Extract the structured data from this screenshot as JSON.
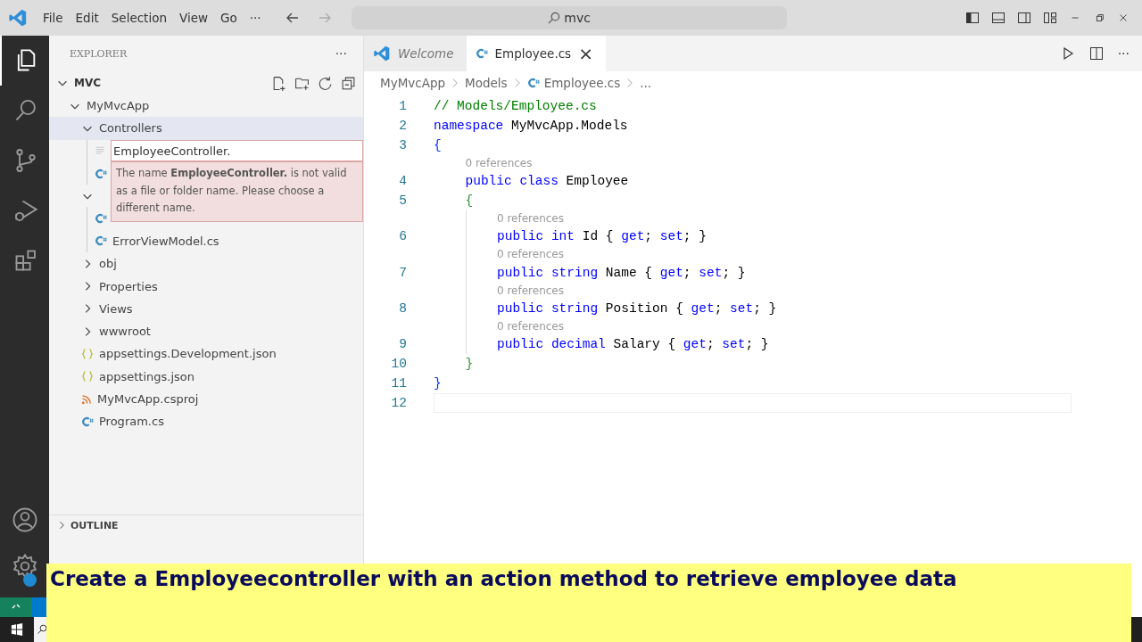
{
  "menu": [
    "File",
    "Edit",
    "Selection",
    "View",
    "Go",
    "···"
  ],
  "search": {
    "value": "mvc"
  },
  "activity_bar": [
    {
      "kind": "explorer",
      "selected": true
    },
    {
      "kind": "search",
      "selected": false
    },
    {
      "kind": "source-control",
      "selected": false
    },
    {
      "kind": "run-debug",
      "selected": false
    },
    {
      "kind": "extensions",
      "selected": false
    }
  ],
  "sidebar": {
    "title": "EXPLORER",
    "more": "···",
    "root": "MVC",
    "tree": [
      {
        "label": "MyMvcApp",
        "kind": "folder",
        "expanded": true,
        "children": [
          {
            "label": "Controllers",
            "kind": "folder",
            "expanded": true,
            "selected": true,
            "children": [
              {
                "kind": "rename",
                "value": "EmployeeController."
              },
              {
                "kind": "csharp"
              }
            ]
          },
          {
            "kind": "folder",
            "expanded": true,
            "children": [
              {
                "kind": "csharp"
              },
              {
                "label": "ErrorViewModel.cs",
                "kind": "csharp"
              }
            ]
          },
          {
            "label": "obj",
            "kind": "folder",
            "expanded": false
          },
          {
            "label": "Properties",
            "kind": "folder",
            "expanded": false
          },
          {
            "label": "Views",
            "kind": "folder",
            "expanded": false
          },
          {
            "label": "wwwroot",
            "kind": "folder",
            "expanded": false
          },
          {
            "label": "appsettings.Development.json",
            "kind": "json"
          },
          {
            "label": "appsettings.json",
            "kind": "json"
          },
          {
            "label": "MyMvcApp.csproj",
            "kind": "rss"
          },
          {
            "label": "Program.cs",
            "kind": "csharp"
          }
        ]
      }
    ],
    "error": "The name **EmployeeController.** is not valid as a file or folder name. Please choose a different name.",
    "outline": "OUTLINE"
  },
  "tabs": [
    {
      "label": "Welcome",
      "kind": "vscode",
      "selected": false
    },
    {
      "label": "Employee.cs",
      "kind": "csharp",
      "selected": true,
      "close": "×"
    }
  ],
  "breadcrumbs": [
    "MyMvcApp",
    "Models",
    "Employee.cs",
    "..."
  ],
  "code": [
    {
      "number": "1",
      "tokens": [
        {
          "t": "// Models/Employee.cs",
          "kind": "comment"
        }
      ]
    },
    {
      "number": "2",
      "tokens": [
        {
          "t": "namespace",
          "kind": "keyword"
        },
        {
          "t": " MyMvcApp.Models",
          "kind": "plain"
        }
      ]
    },
    {
      "number": "3",
      "tokens": [
        {
          "t": "{",
          "kind": "brace"
        }
      ]
    },
    {
      "children": [
        {
          "lens": "0 references"
        },
        {
          "number": "4",
          "tokens": [
            {
              "t": "public class",
              "kind": "keyword"
            },
            {
              "t": " Employee",
              "kind": "plain"
            }
          ]
        },
        {
          "number": "5",
          "tokens": [
            {
              "t": "{",
              "kind": "brace2"
            }
          ]
        },
        {
          "children": [
            {
              "lens": "0 references"
            },
            {
              "number": "6",
              "tokens": [
                {
                  "t": "public int",
                  "kind": "keyword"
                },
                {
                  "t": " Id { ",
                  "kind": "plain"
                },
                {
                  "t": "get",
                  "kind": "keyword"
                },
                {
                  "t": "; ",
                  "kind": "plain"
                },
                {
                  "t": "set",
                  "kind": "keyword"
                },
                {
                  "t": "; }",
                  "kind": "plain"
                }
              ]
            },
            {
              "lens": "0 references"
            },
            {
              "number": "7",
              "tokens": [
                {
                  "t": "public string",
                  "kind": "keyword"
                },
                {
                  "t": " Name { ",
                  "kind": "plain"
                },
                {
                  "t": "get",
                  "kind": "keyword"
                },
                {
                  "t": "; ",
                  "kind": "plain"
                },
                {
                  "t": "set",
                  "kind": "keyword"
                },
                {
                  "t": "; }",
                  "kind": "plain"
                }
              ]
            },
            {
              "lens": "0 references"
            },
            {
              "number": "8",
              "tokens": [
                {
                  "t": "public string",
                  "kind": "keyword"
                },
                {
                  "t": " Position { ",
                  "kind": "plain"
                },
                {
                  "t": "get",
                  "kind": "keyword"
                },
                {
                  "t": "; ",
                  "kind": "plain"
                },
                {
                  "t": "set",
                  "kind": "keyword"
                },
                {
                  "t": "; }",
                  "kind": "plain"
                }
              ]
            },
            {
              "lens": "0 references"
            },
            {
              "number": "9",
              "tokens": [
                {
                  "t": "public decimal",
                  "kind": "keyword"
                },
                {
                  "t": " Salary { ",
                  "kind": "plain"
                },
                {
                  "t": "get",
                  "kind": "keyword"
                },
                {
                  "t": "; ",
                  "kind": "plain"
                },
                {
                  "t": "set",
                  "kind": "keyword"
                },
                {
                  "t": "; }",
                  "kind": "plain"
                }
              ]
            }
          ]
        },
        {
          "number": "10",
          "tokens": [
            {
              "t": "}",
              "kind": "brace2"
            }
          ]
        }
      ]
    },
    {
      "number": "11",
      "tokens": [
        {
          "t": "}",
          "kind": "brace"
        }
      ]
    },
    {
      "number": "12",
      "current": true
    }
  ],
  "caption": "Create a Employeecontroller with an action method to retrieve employee data"
}
